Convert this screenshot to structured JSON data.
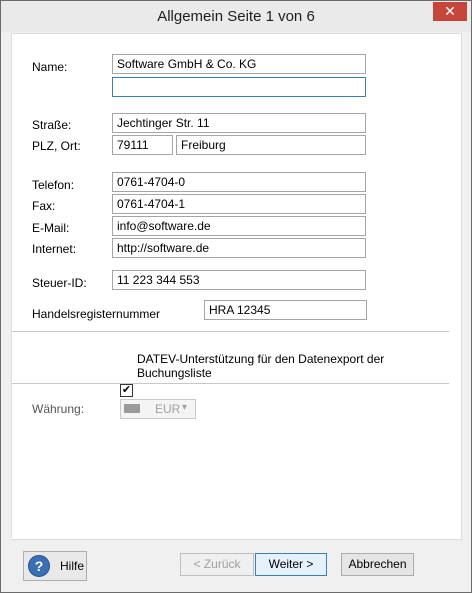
{
  "window": {
    "title": "Allgemein Seite 1 von 6",
    "close_glyph": "✕"
  },
  "form": {
    "name_label": "Name:",
    "name_value": "Software GmbH & Co. KG",
    "name2_value": "",
    "street_label": "Straße:",
    "street_value": "Jechtinger Str. 11",
    "plz_ort_label": "PLZ, Ort:",
    "plz_value": "79111",
    "ort_value": "Freiburg",
    "phone_label": "Telefon:",
    "phone_value": "0761-4704-0",
    "fax_label": "Fax:",
    "fax_value": "0761-4704-1",
    "email_label": "E-Mail:",
    "email_value": "info@software.de",
    "internet_label": "Internet:",
    "internet_value": "http://software.de",
    "tax_label": "Steuer-ID:",
    "tax_value": "11 223 344 553",
    "register_label": "Handelsregisternummer",
    "register_value": "HRA 12345",
    "datev_label": "DATEV-Unterstützung für den Datenexport der Buchungsliste",
    "datev_checked": true,
    "check_glyph": "✔",
    "currency_label": "Währung:",
    "currency_value": "EUR",
    "currency_arrow": "▾"
  },
  "buttons": {
    "help": "Hilfe",
    "help_glyph": "?",
    "back": "< Zurück",
    "next": "Weiter >",
    "cancel": "Abbrechen"
  }
}
